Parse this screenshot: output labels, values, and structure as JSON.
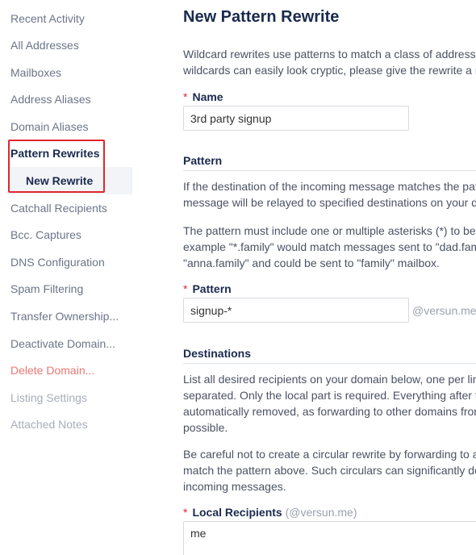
{
  "sidebar": {
    "items": [
      {
        "label": "Recent Activity"
      },
      {
        "label": "All Addresses"
      },
      {
        "label": "Mailboxes"
      },
      {
        "label": "Address Aliases"
      },
      {
        "label": "Domain Aliases"
      },
      {
        "label": "Pattern Rewrites"
      },
      {
        "label": "New Rewrite"
      },
      {
        "label": "Catchall Recipients"
      },
      {
        "label": "Bcc. Captures"
      },
      {
        "label": "DNS Configuration"
      },
      {
        "label": "Spam Filtering"
      },
      {
        "label": "Transfer Ownership..."
      },
      {
        "label": "Deactivate Domain..."
      },
      {
        "label": "Delete Domain..."
      },
      {
        "label": "Listing Settings"
      },
      {
        "label": "Attached Notes"
      }
    ]
  },
  "main": {
    "title": "New Pattern Rewrite",
    "intro": "Wildcard rewrites use patterns to match a class of addresses\nwildcards can easily look cryptic, please give the rewrite a n",
    "name_label": "Name",
    "name_value": "3rd party signup",
    "pattern_section": "Pattern",
    "pattern_text1": "If the destination of the incoming message matches the pat\nmessage will be relayed to specified destinations on your d",
    "pattern_text2": "The pattern must include one or multiple asterisks (*) to be\nexample \"*.family\" would match messages sent to \"dad.fam\n\"anna.family\" and could be sent to \"family\" mailbox.",
    "pattern_label": "Pattern",
    "pattern_value": "signup-*",
    "pattern_suffix": "@versun.me",
    "destinations_section": "Destinations",
    "dest_text1": "List all desired recipients on your domain below, one per lin\nseparated. Only the local part is required. Everything after t\nautomatically removed, as forwarding to other domains fron\npossible.",
    "dest_text2": "Be careful not to create a circular rewrite by forwarding to a\nmatch the pattern above. Such circulars can significantly de\nincoming messages.",
    "local_label": "Local Recipients",
    "local_hint": "(@versun.me)",
    "local_value": "me",
    "required_mark": "*"
  },
  "colors": {
    "accent": "#1a2a4f",
    "danger": "#e87874",
    "required": "#e0262b",
    "highlight_border": "#e0262b"
  }
}
